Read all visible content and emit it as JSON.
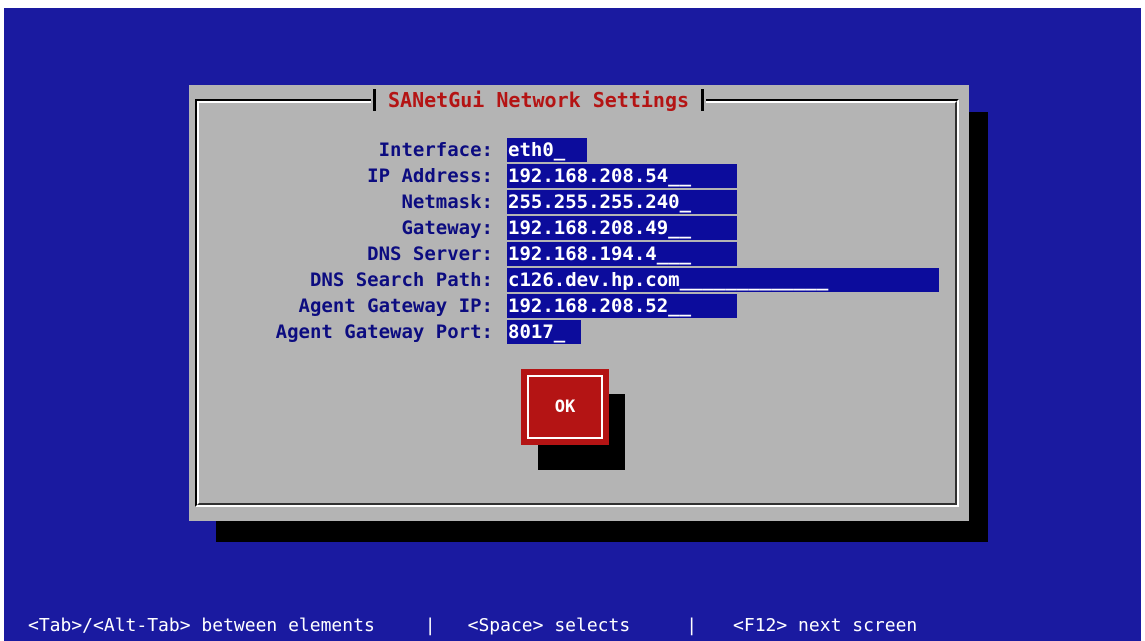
{
  "dialog": {
    "title": "SANetGui Network Settings",
    "ok_label": "OK"
  },
  "fields": [
    {
      "label": "Interface:",
      "value": "eth0_"
    },
    {
      "label": "IP Address:",
      "value": "192.168.208.54__"
    },
    {
      "label": "Netmask:",
      "value": "255.255.255.240_"
    },
    {
      "label": "Gateway:",
      "value": "192.168.208.49__"
    },
    {
      "label": "DNS Server:",
      "value": "192.168.194.4___"
    },
    {
      "label": "DNS Search Path:",
      "value": "c126.dev.hp.com_____________"
    },
    {
      "label": "Agent Gateway IP:",
      "value": "192.168.208.52__"
    },
    {
      "label": "Agent Gateway Port:",
      "value": "8017_"
    }
  ],
  "help": {
    "tab": "<Tab>/<Alt-Tab> between elements",
    "space": "<Space> selects",
    "f12": "<F12> next screen",
    "separator": "|"
  },
  "colors": {
    "background": "#1a1aa0",
    "dialog": "#b4b4b4",
    "title": "#b41414",
    "label": "#0c0c80",
    "input_bg": "#0c0c9c",
    "button": "#b41414"
  }
}
